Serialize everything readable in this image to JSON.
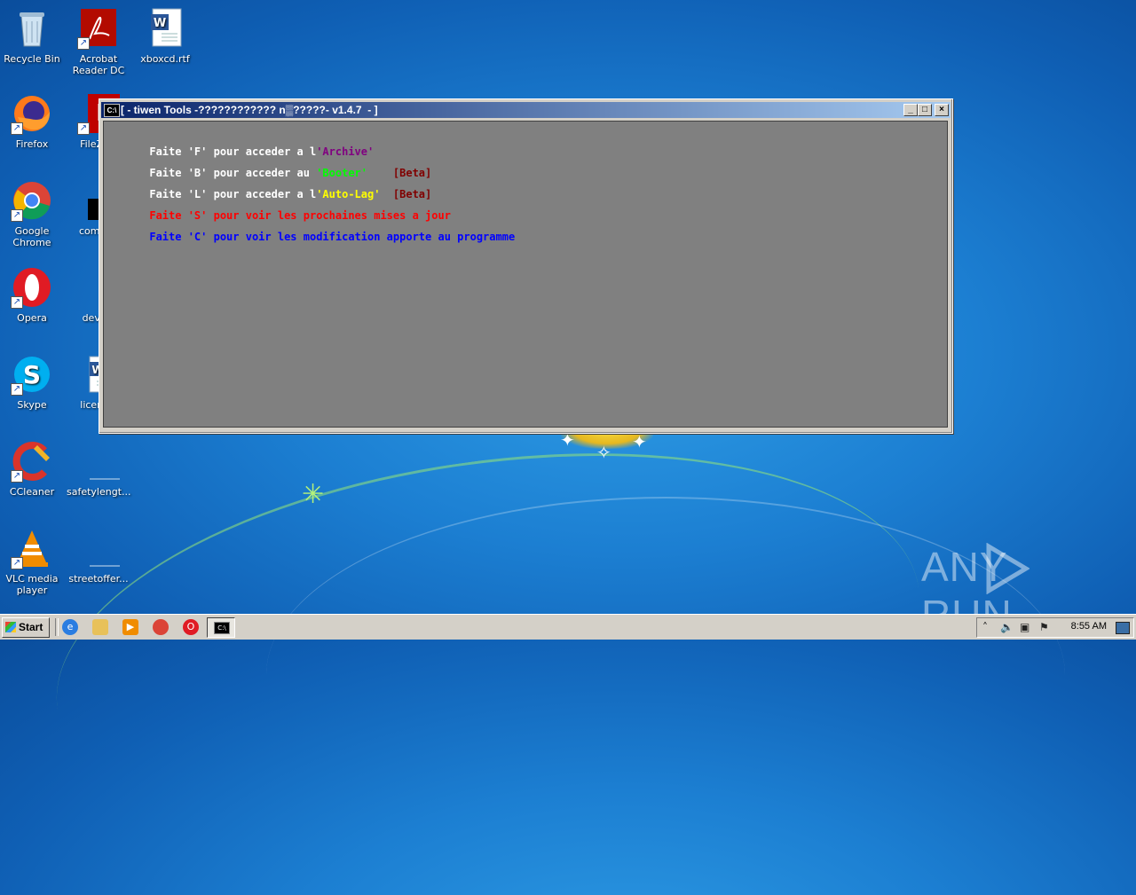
{
  "desktop": {
    "icons": [
      {
        "label": "Recycle Bin",
        "icon": "recycle-bin-icon"
      },
      {
        "label": "Acrobat Reader DC",
        "icon": "acrobat-icon"
      },
      {
        "label": "xboxcd.rtf",
        "icon": "word-document-icon"
      },
      {
        "label": "Firefox",
        "icon": "firefox-icon"
      },
      {
        "label": "FileZilla",
        "icon": "filezilla-icon"
      },
      {
        "label": "Google Chrome",
        "icon": "chrome-icon"
      },
      {
        "label": "comeap",
        "icon": "black-file-icon"
      },
      {
        "label": "Opera",
        "icon": "opera-icon"
      },
      {
        "label": "develo",
        "icon": "file-icon"
      },
      {
        "label": "Skype",
        "icon": "skype-icon"
      },
      {
        "label": "licensel",
        "icon": "word-document-icon"
      },
      {
        "label": "CCleaner",
        "icon": "ccleaner-icon"
      },
      {
        "label": "safetylengt...",
        "icon": "blank-file-icon"
      },
      {
        "label": "VLC media player",
        "icon": "vlc-icon"
      },
      {
        "label": "streetoffer...",
        "icon": "blank-file-icon"
      }
    ]
  },
  "console_window": {
    "title": "[ - tiwen Tools -???????????? n▒?????- v1.4.7  - ]",
    "icon_text": "C:\\",
    "controls": {
      "minimize": "_",
      "maximize": "□",
      "close": "×"
    },
    "lines": [
      {
        "parts": [
          {
            "text": "Faite 'F' pour acceder a l",
            "color": "#ffffff"
          },
          {
            "text": "'Archive'",
            "color": "#800080"
          }
        ]
      },
      {
        "parts": [
          {
            "text": "Faite 'B' pour acceder au ",
            "color": "#ffffff"
          },
          {
            "text": "'Booter'",
            "color": "#00ff00"
          },
          {
            "text": "    [Beta]",
            "color": "#800000"
          }
        ]
      },
      {
        "parts": [
          {
            "text": "Faite 'L' pour acceder a l",
            "color": "#ffffff"
          },
          {
            "text": "'Auto-Lag'",
            "color": "#ffff00"
          },
          {
            "text": "  [Beta]",
            "color": "#800000"
          }
        ]
      },
      {
        "parts": [
          {
            "text": "Faite 'S' pour voir les prochaines mises a jour",
            "color": "#ff0000"
          }
        ]
      },
      {
        "parts": [
          {
            "text": "Faite 'C' pour voir les modification apporte au programme",
            "color": "#0000ff"
          }
        ]
      }
    ]
  },
  "taskbar": {
    "start_label": "Start",
    "quick_launch": [
      "internet-explorer-icon",
      "folder-icon",
      "media-player-icon",
      "chrome-icon",
      "opera-icon"
    ],
    "active_task_icon": "C:\\",
    "clock": "8:55 AM"
  },
  "watermark": {
    "left": "ANY",
    "right": "RUN"
  }
}
